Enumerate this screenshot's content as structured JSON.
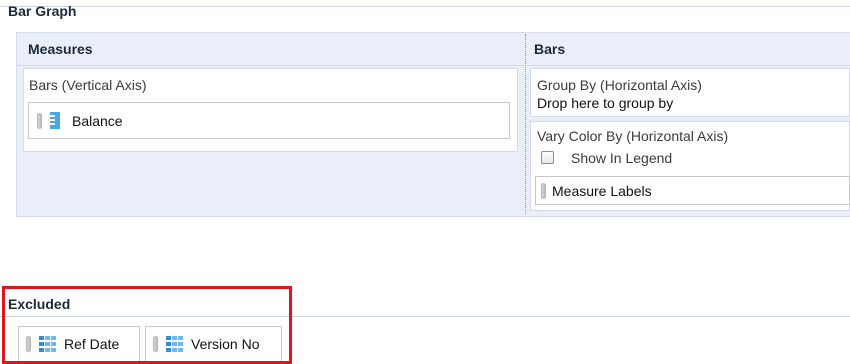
{
  "bar_graph": {
    "title": "Bar Graph",
    "measures": {
      "heading": "Measures",
      "bars_label": "Bars (Vertical Axis)",
      "items": [
        {
          "label": "Balance",
          "icon": "measure-ruler-icon"
        }
      ]
    },
    "bars": {
      "heading": "Bars",
      "group_by_label": "Group By (Horizontal Axis)",
      "group_by_drop_hint": "Drop here to group by",
      "vary_color_label": "Vary Color By (Horizontal Axis)",
      "show_in_legend_label": "Show In Legend",
      "show_in_legend_checked": false,
      "vary_color_items": [
        {
          "label": "Measure Labels"
        }
      ]
    }
  },
  "excluded": {
    "title": "Excluded",
    "items": [
      {
        "label": "Ref Date",
        "icon": "dimension-table-icon"
      },
      {
        "label": "Version No",
        "icon": "dimension-table-icon"
      }
    ]
  },
  "colors": {
    "panel_bg": "#e9eef9",
    "highlight": "#e0141b",
    "icon_blue": "#46a9e6"
  }
}
